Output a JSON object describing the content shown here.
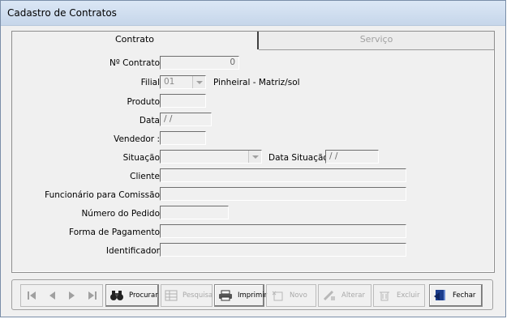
{
  "window": {
    "title": "Cadastro de Contratos"
  },
  "tabs": [
    {
      "label": "Contrato",
      "active": true
    },
    {
      "label": "Serviço",
      "active": false
    }
  ],
  "form": {
    "contrato": {
      "label": "Nº Contrato",
      "value": "0"
    },
    "filial": {
      "label": "Filial",
      "value": "01",
      "description": "Pinheiral - Matriz/sol"
    },
    "produto": {
      "label": "Produto",
      "value": ""
    },
    "data": {
      "label": "Data",
      "value": " / /"
    },
    "vendedor": {
      "label": "Vendedor :",
      "value": ""
    },
    "situacao": {
      "label": "Situação",
      "value": ""
    },
    "data_situacao": {
      "label": "Data Situação",
      "value": " / /"
    },
    "cliente": {
      "label": "Cliente",
      "value": ""
    },
    "funcionario": {
      "label": "Funcionário para Comissão",
      "value": ""
    },
    "numero_pedido": {
      "label": "Número do Pedido",
      "value": ""
    },
    "forma_pagamento": {
      "label": "Forma de Pagamento",
      "value": ""
    },
    "identificador": {
      "label": "Identificador",
      "value": ""
    }
  },
  "toolbar": {
    "procurar": "Procurar",
    "pesquisa": "Pesquisa",
    "imprimir": "Imprimir",
    "novo": "Novo",
    "alterar": "Alterar",
    "excluir": "Excluir",
    "fechar": "Fechar"
  },
  "icons": {
    "first": "first-record-icon",
    "prev": "previous-record-icon",
    "next": "next-record-icon",
    "last": "last-record-icon",
    "procurar": "binoculars-icon",
    "pesquisa": "grid-icon",
    "imprimir": "printer-icon",
    "novo": "new-record-icon",
    "alterar": "edit-icon",
    "excluir": "trash-icon",
    "fechar": "exit-door-icon"
  },
  "colors": {
    "title_bar": "#c6d6ea",
    "window_bg": "#f0f0f0",
    "disabled_text": "#a8a8a8",
    "fechar_icon": "#1a3c8c"
  }
}
